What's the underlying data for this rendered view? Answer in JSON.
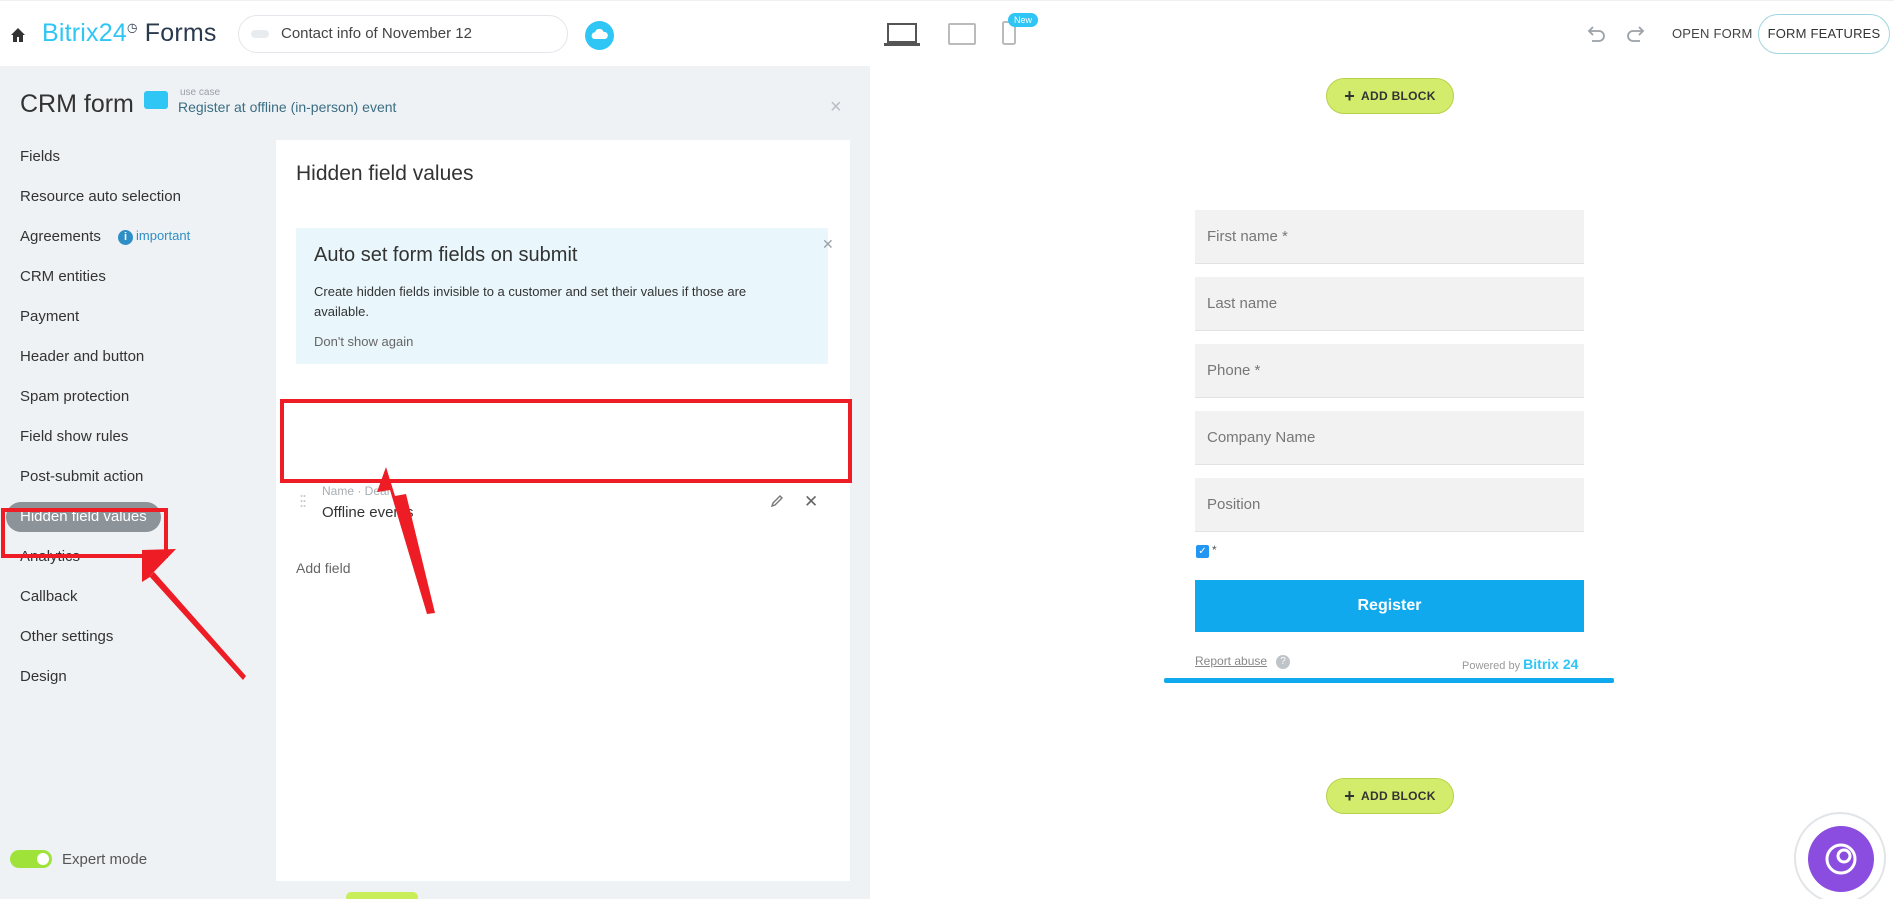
{
  "header": {
    "logo_brand": "Bitrix24",
    "logo_product": "Forms",
    "form_name": "Contact info of November 12",
    "new_badge": "New",
    "open_form": "OPEN FORM",
    "form_features": "FORM FEATURES"
  },
  "panel": {
    "title": "CRM form",
    "usecase_label": "use case",
    "usecase_value": "Register at offline (in-person) event",
    "close": "×"
  },
  "nav": {
    "items": [
      {
        "label": "Fields"
      },
      {
        "label": "Resource auto selection"
      },
      {
        "label": "Agreements"
      },
      {
        "label": "CRM entities"
      },
      {
        "label": "Payment"
      },
      {
        "label": "Header and button"
      },
      {
        "label": "Spam protection"
      },
      {
        "label": "Field show rules"
      },
      {
        "label": "Post-submit action"
      },
      {
        "label": "Hidden field values"
      },
      {
        "label": "Analytics"
      },
      {
        "label": "Callback"
      },
      {
        "label": "Other settings"
      },
      {
        "label": "Design"
      }
    ],
    "active_index": 9,
    "important_badge": "important",
    "expert_mode": "Expert mode"
  },
  "content": {
    "title": "Hidden field values",
    "info_title": "Auto set form fields on submit",
    "info_text": "Create hidden fields invisible to a customer and set their values if those are available.",
    "info_dismiss": "Don't show again",
    "field_label": "Name · Deal",
    "field_value": "Offline events",
    "add_field": "Add field"
  },
  "preview": {
    "add_block": "ADD BLOCK",
    "fields": [
      {
        "placeholder": "First name *"
      },
      {
        "placeholder": "Last name"
      },
      {
        "placeholder": "Phone *"
      },
      {
        "placeholder": "Company Name"
      },
      {
        "placeholder": "Position"
      }
    ],
    "checkbox_star": "*",
    "register": "Register",
    "report_abuse": "Report abuse",
    "powered_by": "Powered by",
    "powered_brand": "Bitrix 24"
  },
  "colors": {
    "accent": "#2fc6f6",
    "register": "#11a9ed",
    "highlight": "#ee1c24",
    "add_block": "#d3ec6b"
  }
}
